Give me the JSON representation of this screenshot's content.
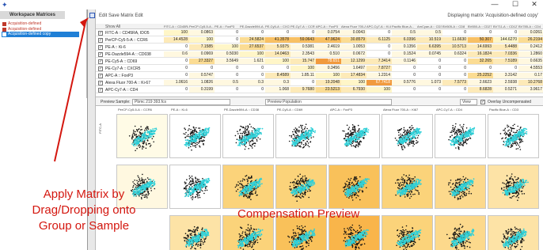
{
  "window": {
    "app_icon": "flowjo-logo-icon",
    "min": "—",
    "max": "☐",
    "close": "✕"
  },
  "workspace": {
    "title": "Workspace Matrices",
    "items": [
      {
        "label": "Acquisition-defined",
        "selected": false
      },
      {
        "label": "Acquisition-defined",
        "selected": false
      },
      {
        "label": "Acquisition-defined copy",
        "selected": true
      }
    ]
  },
  "matrix_window": {
    "title": "Edit  Save Matrix  Edit",
    "status": "Displaying matrix 'Acquisition-defined copy'",
    "show_all": "Show All",
    "columns": [
      "FITC-A :: CD45RA",
      "PerCP-Cy5-5-A...",
      "PE-A :: FoxP3",
      "PE-Dazzle594-A...",
      "PE-Cy5-A :: CXCR...",
      "PE-Cy7-A :: CCR7",
      "APC-A :: FoxP3",
      "Alexa Fluor 700-A...",
      "APC-Cy7-A :: Ki-67",
      "Pacific Blue-A...",
      "AmCyan-A :: CD3",
      "BV605-A :: CD8",
      "BV650-A :: CD27",
      "BV711-A :: CD127",
      "BV785-A :: CD4"
    ],
    "rows": [
      {
        "label": "FITC-A :: CD45RA, IDO5",
        "checked": true,
        "values": [
          "100",
          "0.0863",
          "0",
          "0",
          "0",
          "0",
          "0.0754",
          "0.0043",
          "0",
          "0.5",
          "0.5",
          "0",
          "0",
          "0",
          "0.0261"
        ]
      },
      {
        "label": "PerCP-Cy5-5-A :: CCR6",
        "checked": true,
        "values": [
          "14.4528",
          "100",
          "0",
          "24.5824",
          "41.3578",
          "59.0643",
          "47.9624",
          "30.8579",
          "6.1125",
          "6.0396",
          "10.519",
          "11.6630",
          "50.307",
          "144.6270",
          "26.2194"
        ]
      },
      {
        "label": "PE-A :: Ki-6",
        "checked": true,
        "values": [
          "0",
          "7.1585",
          "100",
          "27.6537",
          "5.9375",
          "0.5381",
          "2.4619",
          "1.0053",
          "0",
          "0.1356",
          "6.6395",
          "10.5713",
          "14.6993",
          "5.4488",
          "0.2412"
        ]
      },
      {
        "label": "PE-Dazzle594-A :: CD038",
        "checked": true,
        "values": [
          "0.6",
          "0.0969",
          "0.5030",
          "100",
          "14.0463",
          "2.3543",
          "0.510",
          "0.0672",
          "0",
          "0.1524",
          "0.0745",
          "0.6324",
          "16.1824",
          "7.0336",
          "1.2860"
        ]
      },
      {
        "label": "PE-Cy5-A :: CD69",
        "checked": true,
        "values": [
          "0",
          "27.3327",
          "3.5649",
          "1.621",
          "100",
          "15.747",
          "78.651",
          "12.1299",
          "7.3414",
          "0.1146",
          "0",
          "0",
          "32.265",
          "7.5189",
          "0.6635"
        ]
      },
      {
        "label": "PE-Cy7-A :: CXCR5",
        "checked": true,
        "values": [
          "0",
          "0",
          "0",
          "0",
          "0",
          "100",
          "0.3456",
          "1.6497",
          "7.8727",
          "0",
          "0",
          "0",
          "0",
          "0",
          "4.5553"
        ]
      },
      {
        "label": "APC-A :: FoxP3",
        "checked": true,
        "values": [
          "0",
          "0.5747",
          "0",
          "0",
          "8.4589",
          "1.85.11",
          "100",
          "17.4834",
          "1.2314",
          "0",
          "0",
          "0",
          "25.2252",
          "3.3142",
          "0.17"
        ]
      },
      {
        "label": "Alexa Fluor 700-A :: Ki-67",
        "checked": true,
        "values": [
          "1.0616",
          "1.0826",
          "0.5",
          "0.3",
          "0.3",
          "0",
          "19.2048",
          "100",
          "67.7418",
          "0.5776",
          "1.073",
          "7.5773",
          "2.6623",
          "2.5938",
          "10.2768"
        ]
      },
      {
        "label": "APC-Cy7-A :: CD4",
        "checked": true,
        "values": [
          "0",
          "0.3199",
          "0",
          "0",
          "1.068",
          "9.7680",
          "23.5213",
          "6.7930",
          "100",
          "0",
          "0",
          "0",
          "8.6828",
          "0.5271",
          "3.9617"
        ]
      }
    ]
  },
  "selectors": {
    "preview_sample_label": "Preview Sample:",
    "preview_sample_value": "Pbmc 219 393.fcs",
    "preview_population_value": "Preview Population",
    "view_label": "View",
    "overlay_label": "Overlay Uncompensated",
    "overlay_checked": true
  },
  "preview": {
    "columns": [
      "PerCP-Cy5-5-A :: CCR6",
      "PE-A :: Ki-6",
      "PE-Dazzle594-A :: CD38",
      "PE-Cy5-A :: CD69",
      "APC-A :: FoxP3",
      "Alexa Fluor 700-A :: Ki67",
      "APC-Cy7-A :: CD4",
      "Pacific Blue-A :: CD3"
    ],
    "row_labels": [
      "FITC-A",
      "",
      "5"
    ],
    "tints": [
      [
        "#fffbe6",
        "#ffffff",
        "#ffffff",
        "#ffffff",
        "#ffffff",
        "#ffffff",
        "#ffffff",
        "#ffffff"
      ],
      [
        "#fff8e0",
        "#ffffff",
        "#fbd37a",
        "#fbd37a",
        "#f9c15a",
        "#fbd37a",
        "#fcd98c",
        "#fde3a6"
      ],
      [
        "#ffffff",
        "#fde3a6",
        "#fbd37a",
        "#f9c15a",
        "#f9b54a",
        "#fbd37a",
        "#fcd98c",
        "#fde3a6"
      ]
    ],
    "colors": {
      "compensated": "#2fd0d8",
      "uncompensated": "#111111"
    }
  },
  "annotations": {
    "apply_matrix": [
      "Apply Matrix by",
      "Drag/Dropping onto",
      "Group or Sample"
    ],
    "compensation_preview": "Compensation Preview",
    "color": "#d4170f"
  }
}
